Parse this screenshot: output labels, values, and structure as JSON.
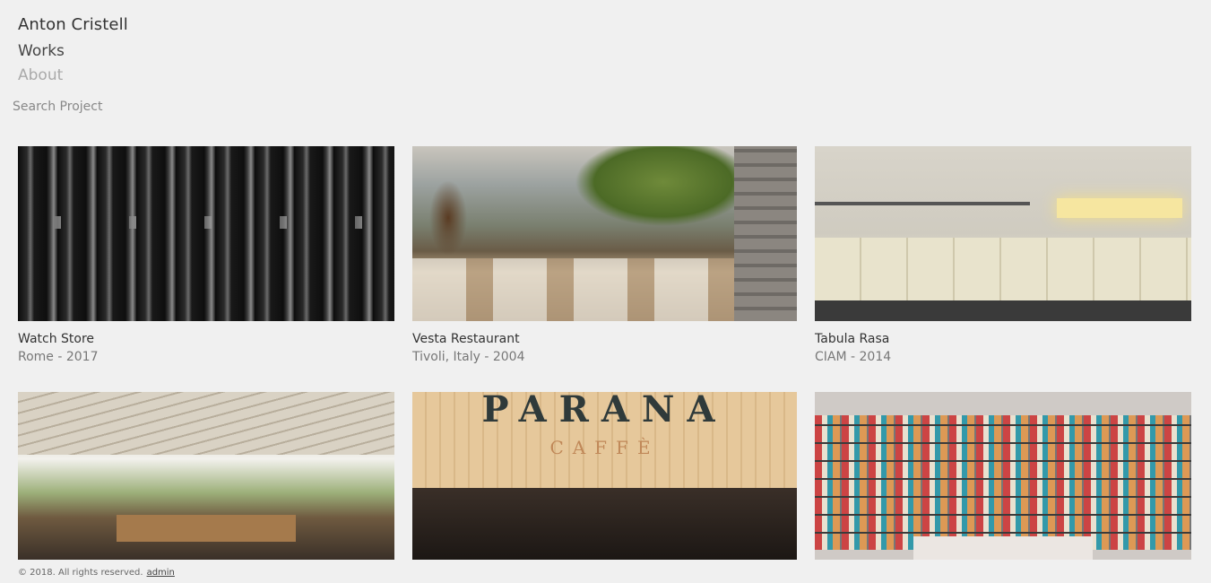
{
  "header": {
    "site_title": "Anton Cristell",
    "nav": {
      "works": "Works",
      "about": "About"
    },
    "search_placeholder": "Search Project"
  },
  "projects": [
    {
      "title": "Watch Store",
      "meta": "Rome - 2017"
    },
    {
      "title": "Vesta Restaurant",
      "meta": "Tivoli, Italy - 2004"
    },
    {
      "title": "Tabula Rasa",
      "meta": "CIAM - 2014"
    },
    {
      "title": "",
      "meta": ""
    },
    {
      "title": "",
      "meta": "",
      "sign_word": "PARANA",
      "sign_sub": "CAFFÈ"
    },
    {
      "title": "",
      "meta": ""
    }
  ],
  "footer": {
    "copyright": "© 2018. All rights reserved.",
    "admin_link": "admin"
  }
}
